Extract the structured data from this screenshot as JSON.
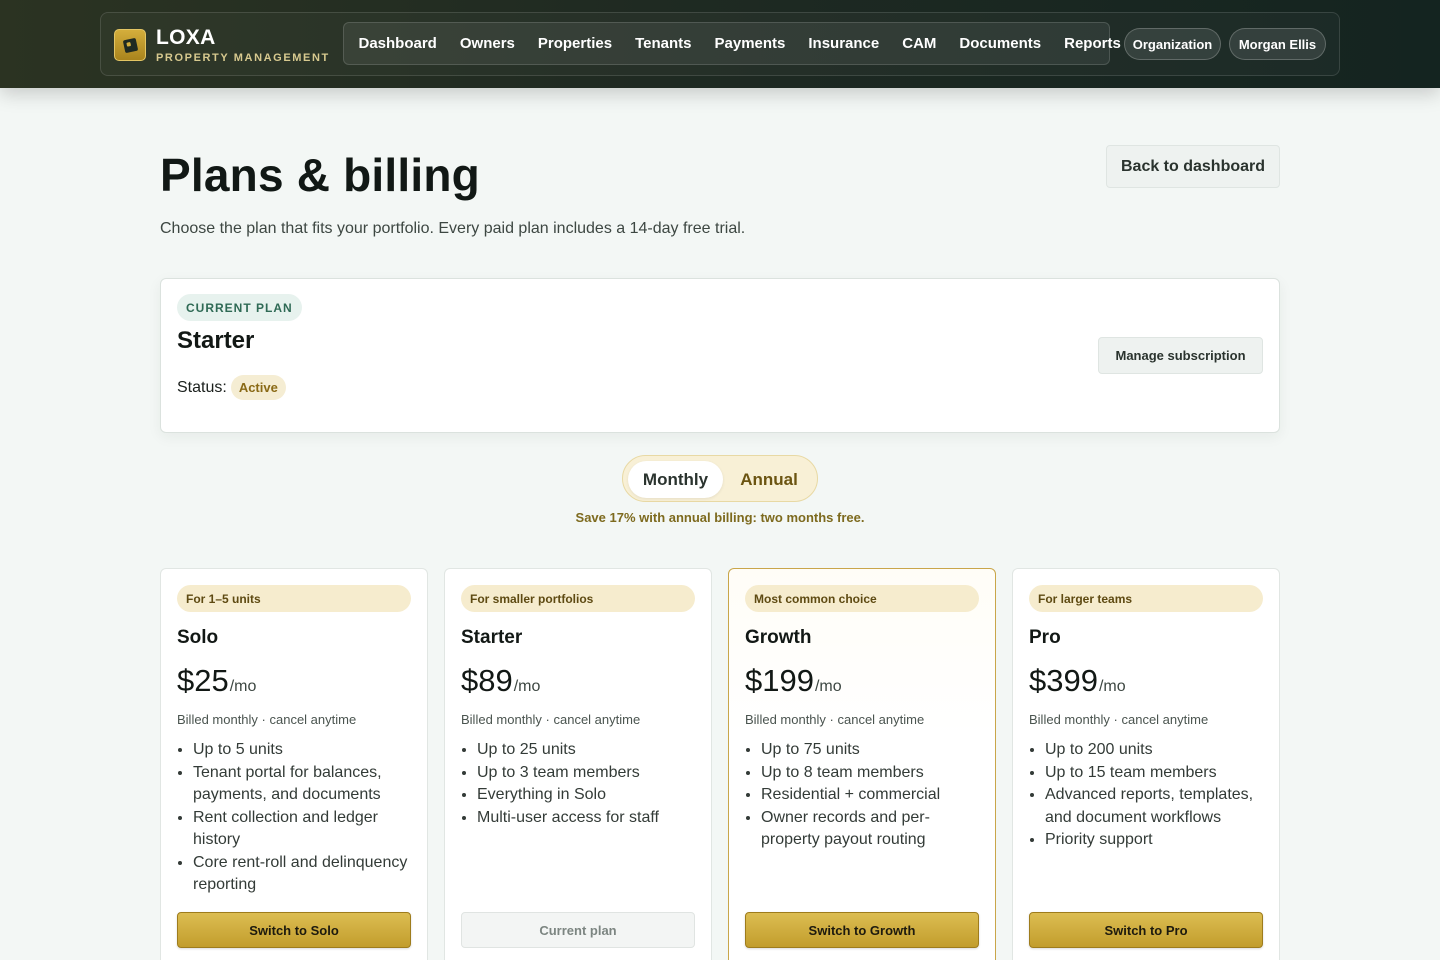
{
  "brand": {
    "name": "LOXA",
    "subtitle": "PROPERTY MANAGEMENT"
  },
  "nav": {
    "items": [
      "Dashboard",
      "Owners",
      "Properties",
      "Tenants",
      "Payments",
      "Insurance",
      "CAM",
      "Documents",
      "Reports"
    ],
    "organization_label": "Organization",
    "user_label": "Morgan Ellis"
  },
  "header": {
    "title": "Plans & billing",
    "subtitle": "Choose the plan that fits your portfolio. Every paid plan includes a 14-day free trial.",
    "back_label": "Back to dashboard"
  },
  "current_plan": {
    "label": "CURRENT PLAN",
    "name": "Starter",
    "status_label": "Status:",
    "status_value": "Active",
    "manage_label": "Manage subscription"
  },
  "billing_toggle": {
    "options": [
      "Monthly",
      "Annual"
    ],
    "selected": "Monthly",
    "note": "Save 17% with annual billing: two months free."
  },
  "plans": [
    {
      "tag": "For 1–5 units",
      "name": "Solo",
      "price": "$25",
      "per": "/mo",
      "billing": "Billed monthly · cancel anytime",
      "features": [
        "Up to 5 units",
        "Tenant portal for balances, payments, and documents",
        "Rent collection and ledger history",
        "Core rent-roll and delinquency reporting"
      ],
      "button": "Switch to Solo",
      "is_current": false
    },
    {
      "tag": "For smaller portfolios",
      "name": "Starter",
      "price": "$89",
      "per": "/mo",
      "billing": "Billed monthly · cancel anytime",
      "features": [
        "Up to 25 units",
        "Up to 3 team members",
        "Everything in Solo",
        "Multi-user access for staff"
      ],
      "button": "Current plan",
      "is_current": true
    },
    {
      "tag": "Most common choice",
      "name": "Growth",
      "price": "$199",
      "per": "/mo",
      "billing": "Billed monthly · cancel anytime",
      "features": [
        "Up to 75 units",
        "Up to 8 team members",
        "Residential + commercial",
        "Owner records and per-property payout routing"
      ],
      "button": "Switch to Growth",
      "is_current": false
    },
    {
      "tag": "For larger teams",
      "name": "Pro",
      "price": "$399",
      "per": "/mo",
      "billing": "Billed monthly · cancel anytime",
      "features": [
        "Up to 200 units",
        "Up to 15 team members",
        "Advanced reports, templates, and document workflows",
        "Priority support"
      ],
      "button": "Switch to Pro",
      "is_current": false
    }
  ],
  "colors": {
    "accent_gold": "#c9a43a",
    "topbar_dark": "#1f2a22",
    "badge_green_text": "#2f6a55"
  }
}
